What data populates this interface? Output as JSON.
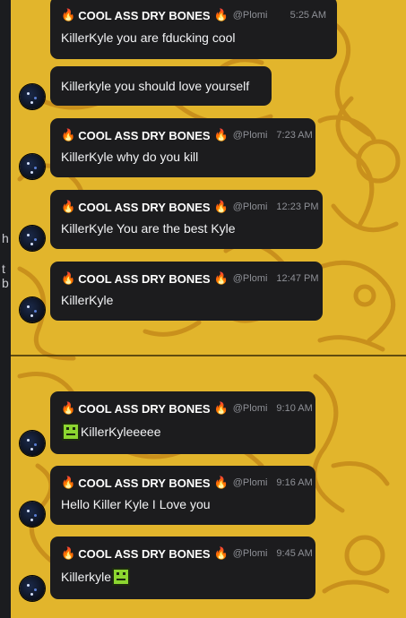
{
  "left_edge": {
    "frag1": "h",
    "frag2": "t b"
  },
  "user": {
    "name": "COOL ASS DRY BONES",
    "handle": "@Plomi",
    "name_emoji": "🔥"
  },
  "messages": [
    {
      "time": "5:25 AM",
      "text": "KillerKyle you are fducking cool",
      "show_header": true
    },
    {
      "time": "",
      "text": "Killerkyle you should love yourself",
      "show_header": false
    },
    {
      "time": "7:23 AM",
      "text": "KillerKyle why do you kill",
      "show_header": true
    },
    {
      "time": "12:23 PM",
      "text": "KillerKyle You are the best Kyle",
      "show_header": true
    },
    {
      "time": "12:47 PM",
      "text": "KillerKyle",
      "show_header": true
    },
    {
      "time": "9:10 AM",
      "text": "KillerKyleeeee",
      "show_header": true,
      "emoji_before": "green-face-emoji"
    },
    {
      "time": "9:16 AM",
      "text": "Hello Killer Kyle I Love you",
      "show_header": true
    },
    {
      "time": "9:45 AM",
      "text": "Killerkyle",
      "show_header": true,
      "emoji_after": "green-face-emoji"
    }
  ],
  "colors": {
    "wallpaper": "#e2b52c",
    "doodle": "#c9901c",
    "bubble": "#1c1c1e",
    "meta": "#8e9096",
    "emoji_green": "#8cd630"
  }
}
